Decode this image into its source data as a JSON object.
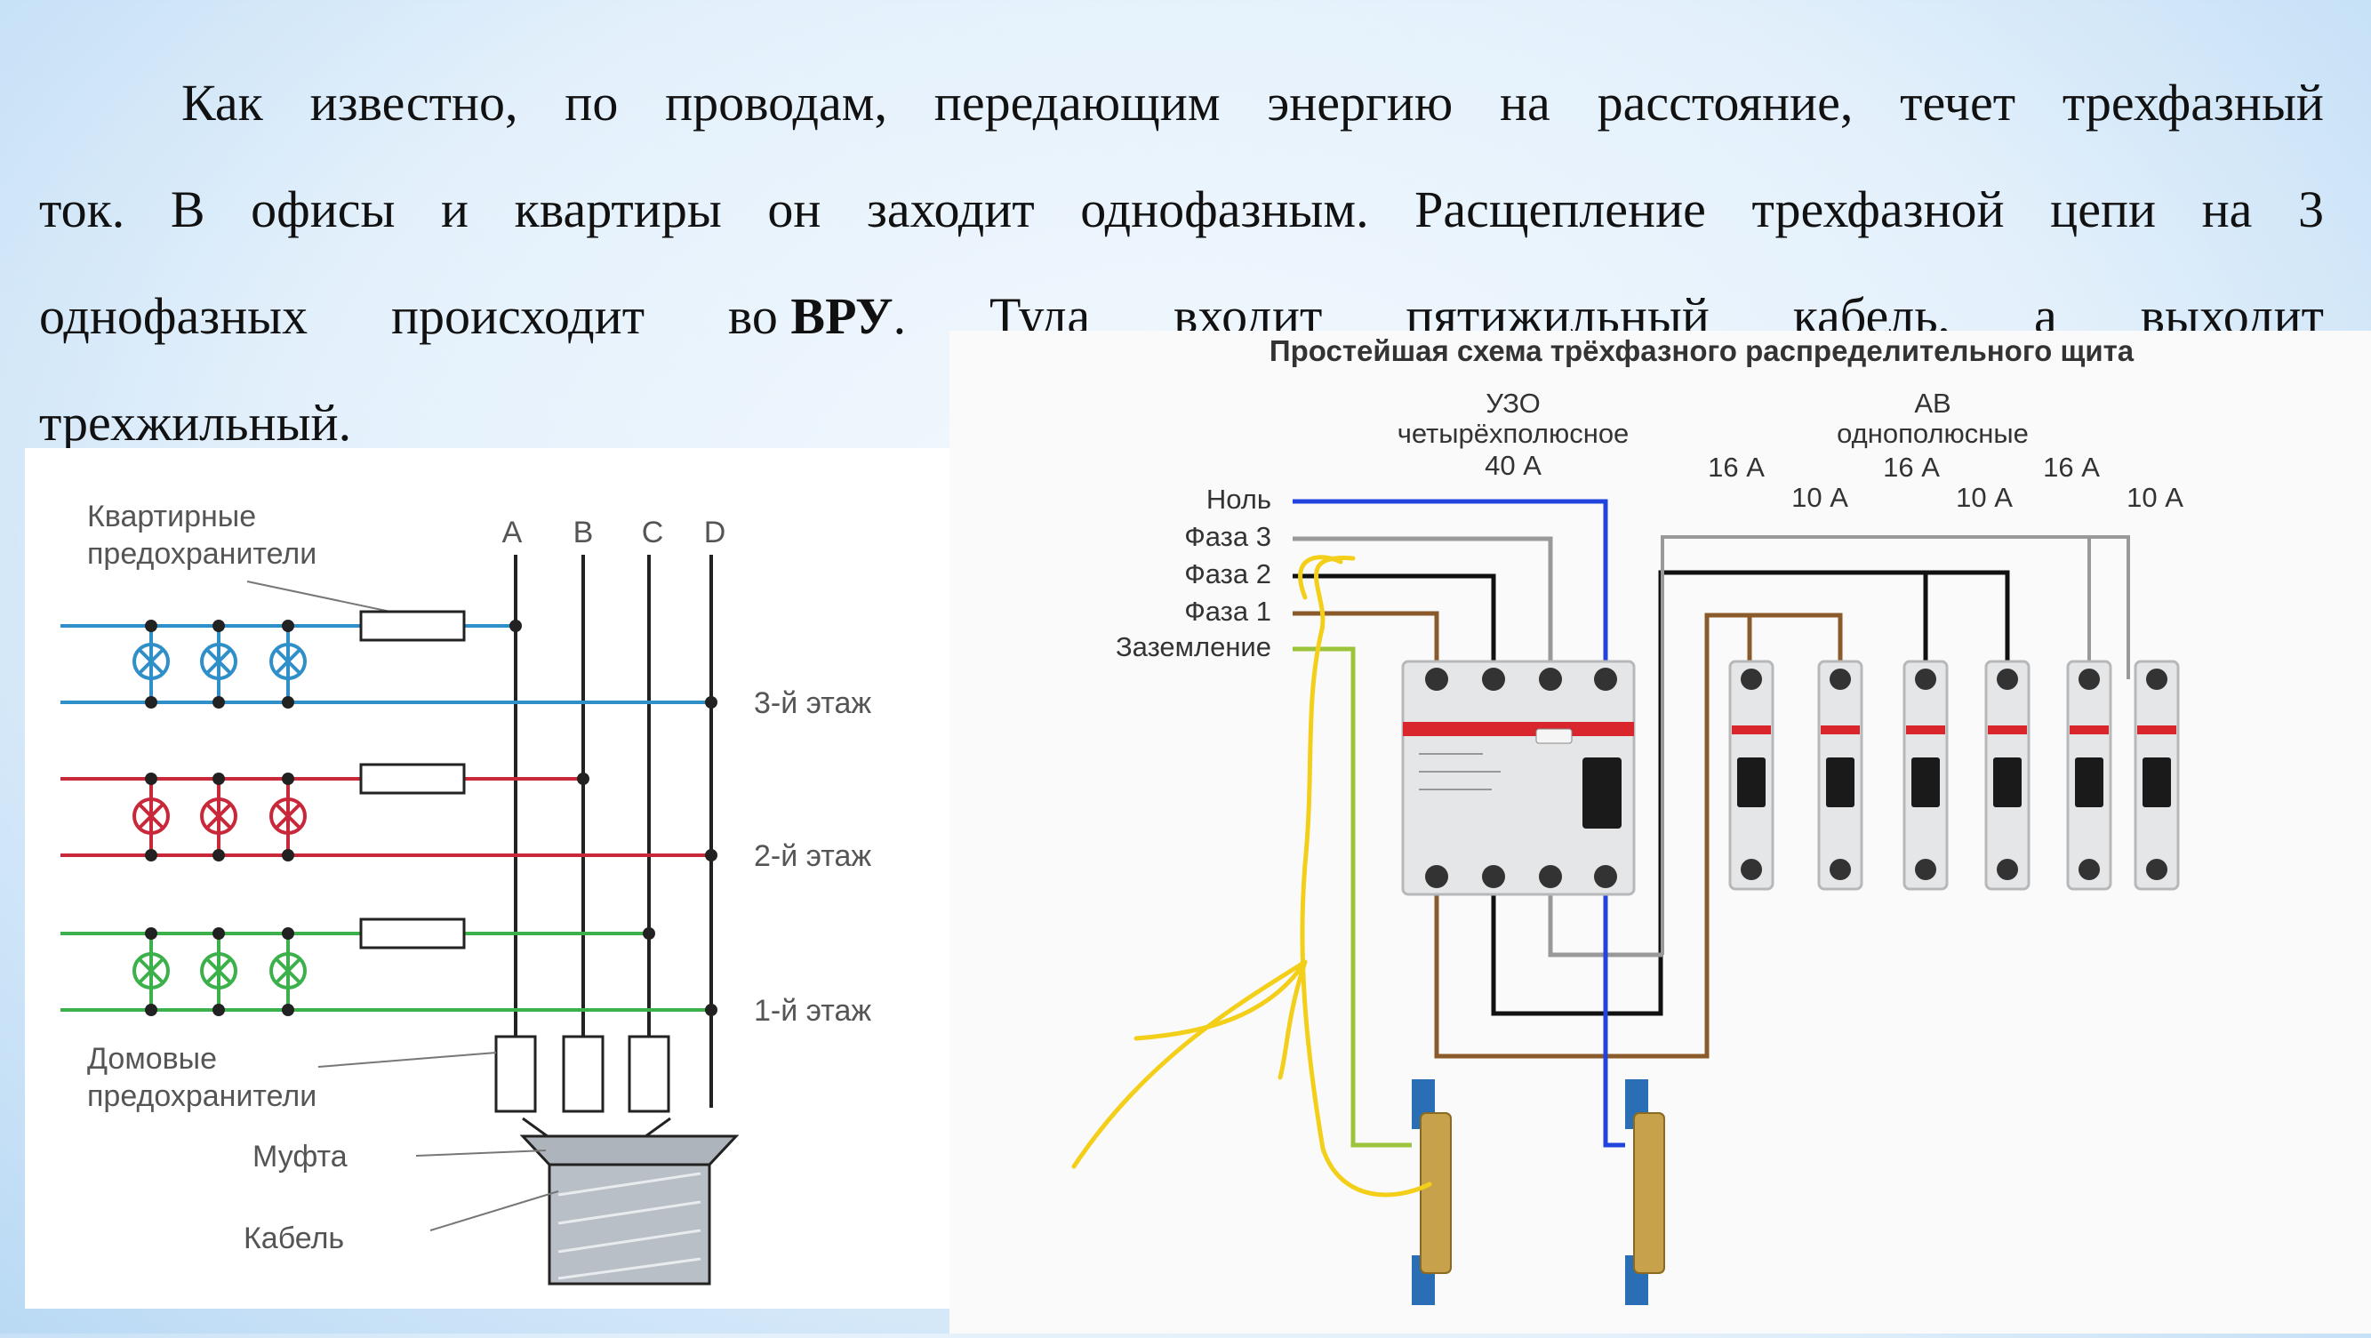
{
  "paragraph": {
    "line1": [
      "Как",
      "известно,",
      "по",
      "проводам,",
      "передающим",
      "энергию",
      "на",
      "расстояние,",
      "течет",
      "трехфазный"
    ],
    "line2": [
      "ток.",
      "В",
      "офисы",
      "и",
      "квартиры",
      "он",
      "заходит",
      "однофазным.",
      "Расщепление",
      "трехфазной",
      "цепи",
      "на",
      "3"
    ],
    "line3_a": "однофазных",
    "line3_b": "происходит",
    "line3_c": "во",
    "line3_bold": "ВРУ",
    "line3_d": ".",
    "line3_e": "Туда",
    "line3_f": "входит",
    "line3_g": "пятижильный",
    "line3_h": "кабель,",
    "line3_i": "а",
    "line3_j": "выходит",
    "line4": "трехжильный."
  },
  "left_diagram": {
    "apartment_fuses": [
      "Квартирные",
      "предохранители"
    ],
    "columns": [
      "A",
      "B",
      "C",
      "D"
    ],
    "floors": [
      "3-й этаж",
      "2-й этаж",
      "1-й этаж"
    ],
    "house_fuses": [
      "Домовые",
      "предохранители"
    ],
    "coupling": "Муфта",
    "cable": "Кабель",
    "colors": {
      "floor3": "#2f8fc8",
      "floor2": "#c8283a",
      "floor1": "#3cb04a",
      "bus": "#222222"
    }
  },
  "right_diagram": {
    "title": "Простейшая схема трёхфазного распределительного щита",
    "rcd_label": [
      "УЗО",
      "четырёхполюсное",
      "40 А"
    ],
    "breakers_label": [
      "АВ",
      "однополюсные"
    ],
    "ratings_top": [
      "16 А",
      "16 А",
      "16 А"
    ],
    "ratings_bottom": [
      "10 А",
      "10 А",
      "10 А"
    ],
    "wires": [
      "Ноль",
      "Фаза 3",
      "Фаза 2",
      "Фаза 1",
      "Заземление"
    ],
    "colors": {
      "neutral": "#2244dd",
      "phase3": "#999999",
      "phase2": "#111111",
      "phase1": "#8a5a2b",
      "ground": "#9cc43a",
      "highlight": "#f3cf1a"
    }
  }
}
